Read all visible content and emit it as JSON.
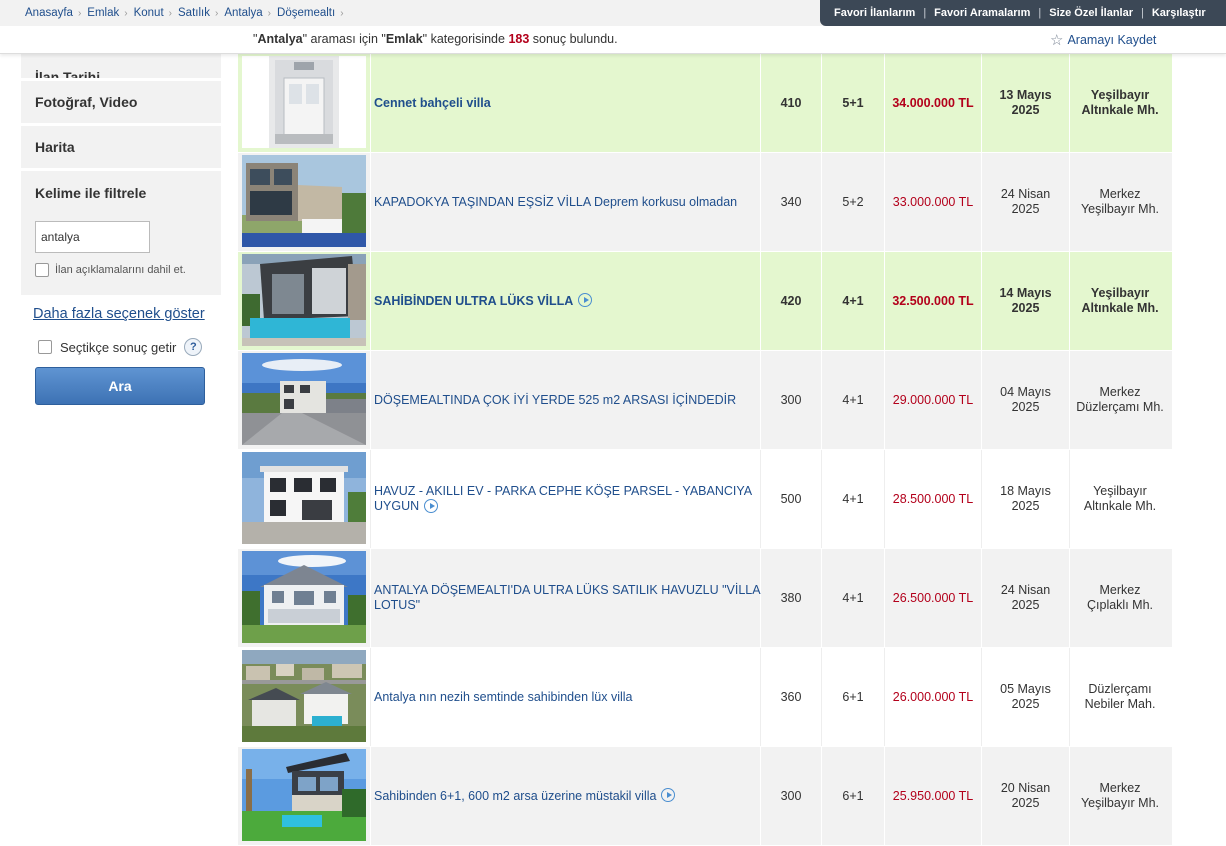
{
  "breadcrumb": [
    "Anasayfa",
    "Emlak",
    "Konut",
    "Satılık",
    "Antalya",
    "Döşemealtı"
  ],
  "topnav": [
    "Favori İlanlarım",
    "Favori Aramalarım",
    "Size Özel İlanlar",
    "Karşılaştır"
  ],
  "result": {
    "query": "Antalya",
    "text1": "araması için",
    "category": "Emlak",
    "text2": "kategorisinde",
    "count": "183",
    "text3": "sonuç bulundu."
  },
  "save_search": "Aramayı Kaydet",
  "sidebar": {
    "tarih_label": "İlan Tarihi",
    "foto_label": "Fotoğraf, Video",
    "harita_label": "Harita",
    "kelime_label": "Kelime ile filtrele",
    "kelime_value": "antalya",
    "include_desc_label": "İlan açıklamalarını dahil et.",
    "more_options": "Daha fazla seçenek göster",
    "select_label": "Seçtikçe sonuç getir",
    "help": "?",
    "search_button": "Ara"
  },
  "listings": [
    {
      "style": "fav",
      "title": "Cennet bahçeli villa",
      "video": false,
      "m2": "410",
      "rooms": "5+1",
      "price": "34.000.000 TL",
      "date1": "13 Mayıs",
      "date2": "2025",
      "loc1": "Yeşilbayır",
      "loc2": "Altınkale Mh.",
      "thumb": "door"
    },
    {
      "style": "gray",
      "title": "KAPADOKYA TAŞINDAN EŞSİZ VİLLA Deprem korkusu olmadan",
      "video": false,
      "m2": "340",
      "rooms": "5+2",
      "price": "33.000.000 TL",
      "date1": "24 Nisan",
      "date2": "2025",
      "loc1": "Merkez",
      "loc2": "Yeşilbayır Mh.",
      "thumb": "stone"
    },
    {
      "style": "fav",
      "title": "SAHİBİNDEN ULTRA LÜKS VİLLA",
      "video": true,
      "m2": "420",
      "rooms": "4+1",
      "price": "32.500.000 TL",
      "date1": "14 Mayıs",
      "date2": "2025",
      "loc1": "Yeşilbayır",
      "loc2": "Altınkale Mh.",
      "thumb": "pool"
    },
    {
      "style": "gray",
      "title": "DÖŞEMEALTINDA ÇOK İYİ YERDE 525 m2 ARSASI İÇİNDEDİR",
      "video": false,
      "m2": "300",
      "rooms": "4+1",
      "price": "29.000.000 TL",
      "date1": "04 Mayıs",
      "date2": "2025",
      "loc1": "Merkez",
      "loc2": "Düzlerçamı Mh.",
      "thumb": "street"
    },
    {
      "style": "white",
      "title": "HAVUZ - AKILLI EV - PARKA CEPHE KÖŞE PARSEL - YABANCIYA UYGUN",
      "video": true,
      "m2": "500",
      "rooms": "4+1",
      "price": "28.500.000 TL",
      "date1": "18 Mayıs",
      "date2": "2025",
      "loc1": "Yeşilbayır",
      "loc2": "Altınkale Mh.",
      "thumb": "white"
    },
    {
      "style": "gray",
      "title": "ANTALYA DÖŞEMEALTI'DA ULTRA LÜKS SATILIK HAVUZLU \"VİLLA LOTUS\"",
      "video": false,
      "m2": "380",
      "rooms": "4+1",
      "price": "26.500.000 TL",
      "date1": "24 Nisan",
      "date2": "2025",
      "loc1": "Merkez",
      "loc2": "Çıplaklı Mh.",
      "thumb": "lotus"
    },
    {
      "style": "white",
      "title": "Antalya nın nezih semtinde sahibinden lüx villa",
      "video": false,
      "m2": "360",
      "rooms": "6+1",
      "price": "26.000.000 TL",
      "date1": "05 Mayıs",
      "date2": "2025",
      "loc1": "Düzlerçamı",
      "loc2": "Nebiler Mah.",
      "thumb": "aerial"
    },
    {
      "style": "gray",
      "title": "Sahibinden 6+1, 600 m2 arsa üzerine müstakil villa",
      "video": true,
      "m2": "300",
      "rooms": "6+1",
      "price": "25.950.000 TL",
      "date1": "20 Nisan",
      "date2": "2025",
      "loc1": "Merkez",
      "loc2": "Yeşilbayır Mh.",
      "thumb": "modern"
    }
  ]
}
